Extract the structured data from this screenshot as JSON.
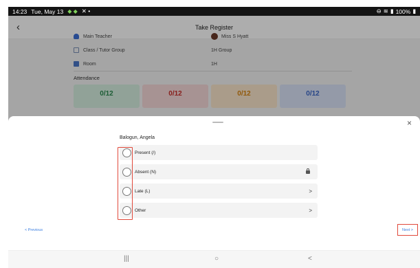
{
  "status_bar": {
    "time": "14:23",
    "date": "Tue, May 13",
    "battery": "100%"
  },
  "header": {
    "title": "Take Register",
    "back_icon": "back-chevron-icon"
  },
  "info": {
    "rows": [
      {
        "label": "Main Teacher",
        "value": "Miss S Hyatt"
      },
      {
        "label": "Class / Tutor Group",
        "value": "1H Group"
      },
      {
        "label": "Room",
        "value": "1H"
      }
    ]
  },
  "attendance": {
    "title": "Attendance",
    "counts": [
      "0/12",
      "0/12",
      "0/12",
      "0/12"
    ]
  },
  "sheet": {
    "student_name": "Balogun, Angela",
    "options": [
      {
        "label": "Present (/)",
        "trail": ""
      },
      {
        "label": "Absent (N)",
        "trail": "lock"
      },
      {
        "label": "Late (L)",
        "trail": ">"
      },
      {
        "label": "Other",
        "trail": ">"
      }
    ],
    "previous_label": "< Previous",
    "next_label": "Next >",
    "close_label": "×"
  },
  "nav": {
    "recent": "|||",
    "home": "○",
    "back": "<"
  }
}
